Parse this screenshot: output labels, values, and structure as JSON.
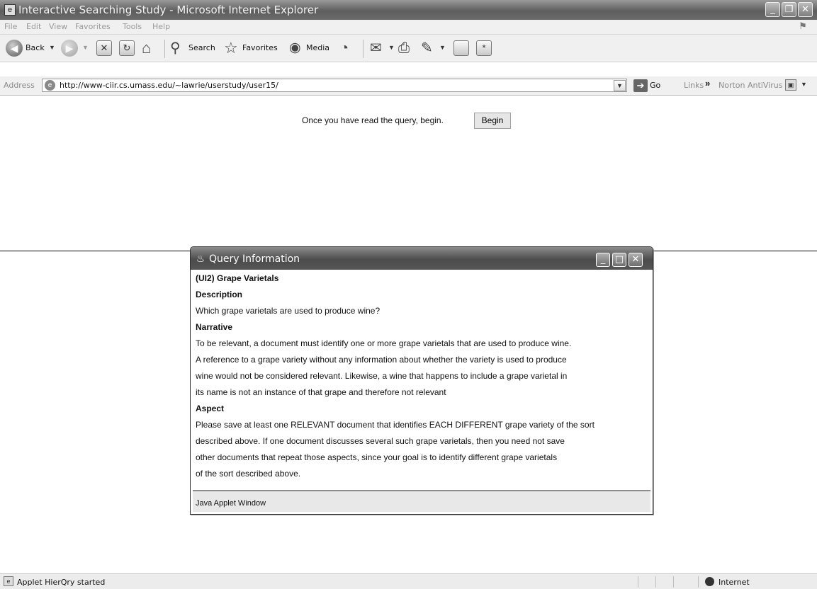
{
  "window": {
    "title": "Interactive Searching Study - Microsoft Internet Explorer",
    "minimize_glyph": "_",
    "restore_glyph": "❐",
    "close_glyph": "✕"
  },
  "menu": [
    "File",
    "Edit",
    "View",
    "Favorites",
    "Tools",
    "Help"
  ],
  "toolbar": {
    "back_label": "Back",
    "search_label": "Search",
    "favorites_label": "Favorites",
    "media_label": "Media"
  },
  "address": {
    "label": "Address",
    "url": "http://www-ciir.cs.umass.edu/~lawrie/userstudy/user15/",
    "go_label": "Go",
    "links_label": "Links",
    "links_chevron": "»",
    "norton_label": "Norton AntiVirus"
  },
  "content": {
    "prompt": "Once you have read the query, begin.",
    "begin_button": "Begin"
  },
  "query_window": {
    "title": "Query Information",
    "lines": [
      {
        "text": "(UI2) Grape Varietals",
        "bold": true
      },
      {
        "text": "Description",
        "bold": true
      },
      {
        "text": "Which grape varietals are used to produce wine?",
        "bold": false
      },
      {
        "text": "Narrative",
        "bold": true
      },
      {
        "text": "To be relevant, a document must identify one or more grape varietals that are used to produce wine.",
        "bold": false
      },
      {
        "text": "A reference to a grape variety without any information about whether the variety is used to produce",
        "bold": false
      },
      {
        "text": "wine would not be considered relevant. Likewise, a wine that happens to include a grape varietal in",
        "bold": false
      },
      {
        "text": "its name is not an instance of that grape and therefore not relevant",
        "bold": false
      },
      {
        "text": "Aspect",
        "bold": true
      },
      {
        "text": "Please save at least one RELEVANT document that identifies EACH DIFFERENT grape variety of the sort",
        "bold": false
      },
      {
        "text": "described above. If one document discusses several such grape varietals, then you need not save",
        "bold": false
      },
      {
        "text": "other documents that repeat those aspects, since your goal is to identify different grape varietals",
        "bold": false
      },
      {
        "text": "of the sort described above.",
        "bold": false
      }
    ],
    "footer": "Java Applet Window"
  },
  "status": {
    "text": "Applet HierQry started",
    "zone": "Internet"
  }
}
